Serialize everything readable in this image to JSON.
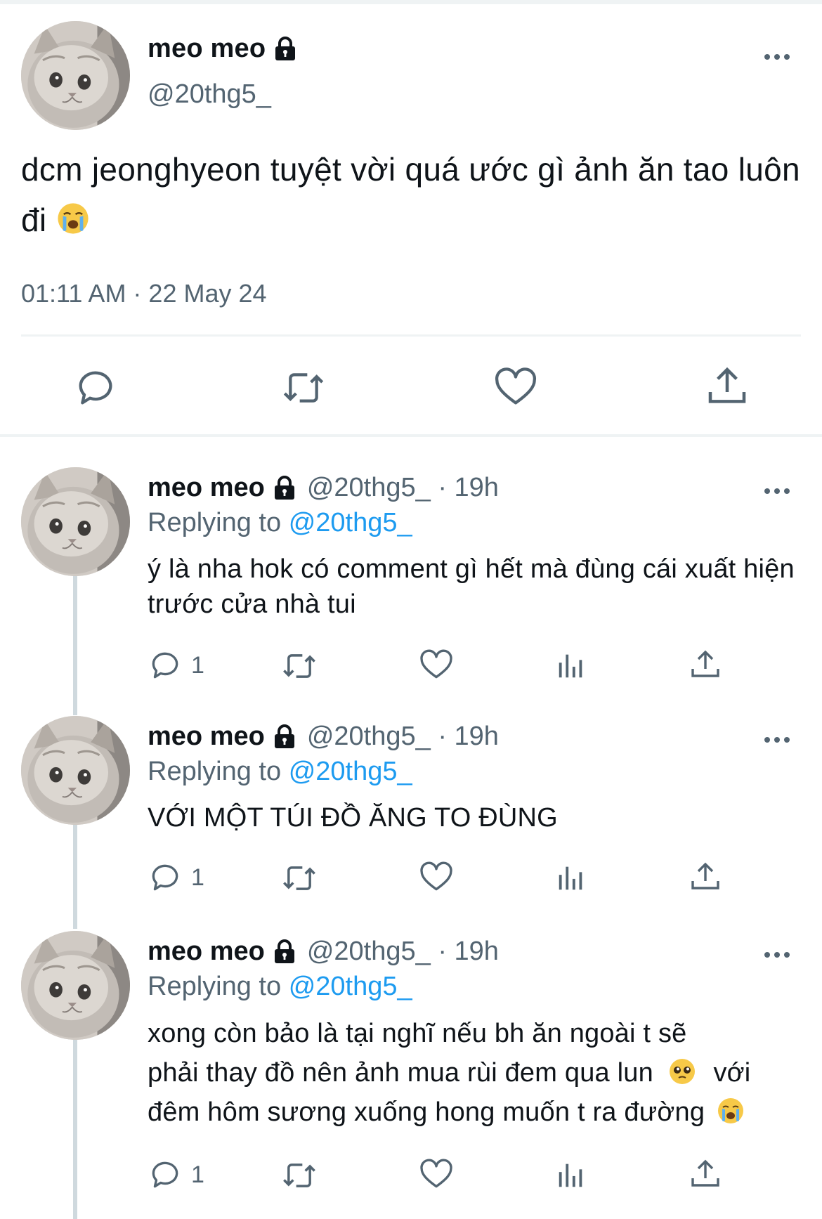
{
  "main_tweet": {
    "display_name": "meo meo",
    "handle": "@20thg5_",
    "text": "dcm jeonghyeon tuyệt vời quá ước gì ảnh ăn tao luôn đi",
    "timestamp": "01:11 AM · 22 May 24"
  },
  "replies": [
    {
      "display_name": "meo meo",
      "handle_time": "@20thg5_ · 19h",
      "replying_label": "Replying to",
      "replying_handle": "@20thg5_",
      "text": "ý là nha hok có comment gì hết mà đùng cái xuất hiện trước cửa nhà tui",
      "reply_count": "1"
    },
    {
      "display_name": "meo meo",
      "handle_time": "@20thg5_ · 19h",
      "replying_label": "Replying to",
      "replying_handle": "@20thg5_",
      "text": "VỚI MỘT TÚI ĐỒ ĂNG TO ĐÙNG",
      "reply_count": "1"
    },
    {
      "display_name": "meo meo",
      "handle_time": "@20thg5_ · 19h",
      "replying_label": "Replying to",
      "replying_handle": "@20thg5_",
      "text_line1": "xong còn bảo là tại nghĩ nếu bh ăn ngoài t sẽ",
      "text_line2a": "phải thay đồ nên ảnh mua rùi đem qua lun",
      "text_line2b": "với",
      "text_line3": "đêm hôm sương xuống hong muốn t ra đường",
      "reply_count": "1"
    }
  ],
  "colors": {
    "text": "#0f1419",
    "secondary": "#536471",
    "link": "#1d9bf0",
    "rule": "#eff3f4",
    "thread_line": "#cfd9de"
  },
  "icons": [
    "lock-icon",
    "more-icon",
    "reply-icon",
    "retweet-icon",
    "like-icon",
    "share-icon",
    "views-icon",
    "crying-emoji",
    "pleading-emoji"
  ]
}
